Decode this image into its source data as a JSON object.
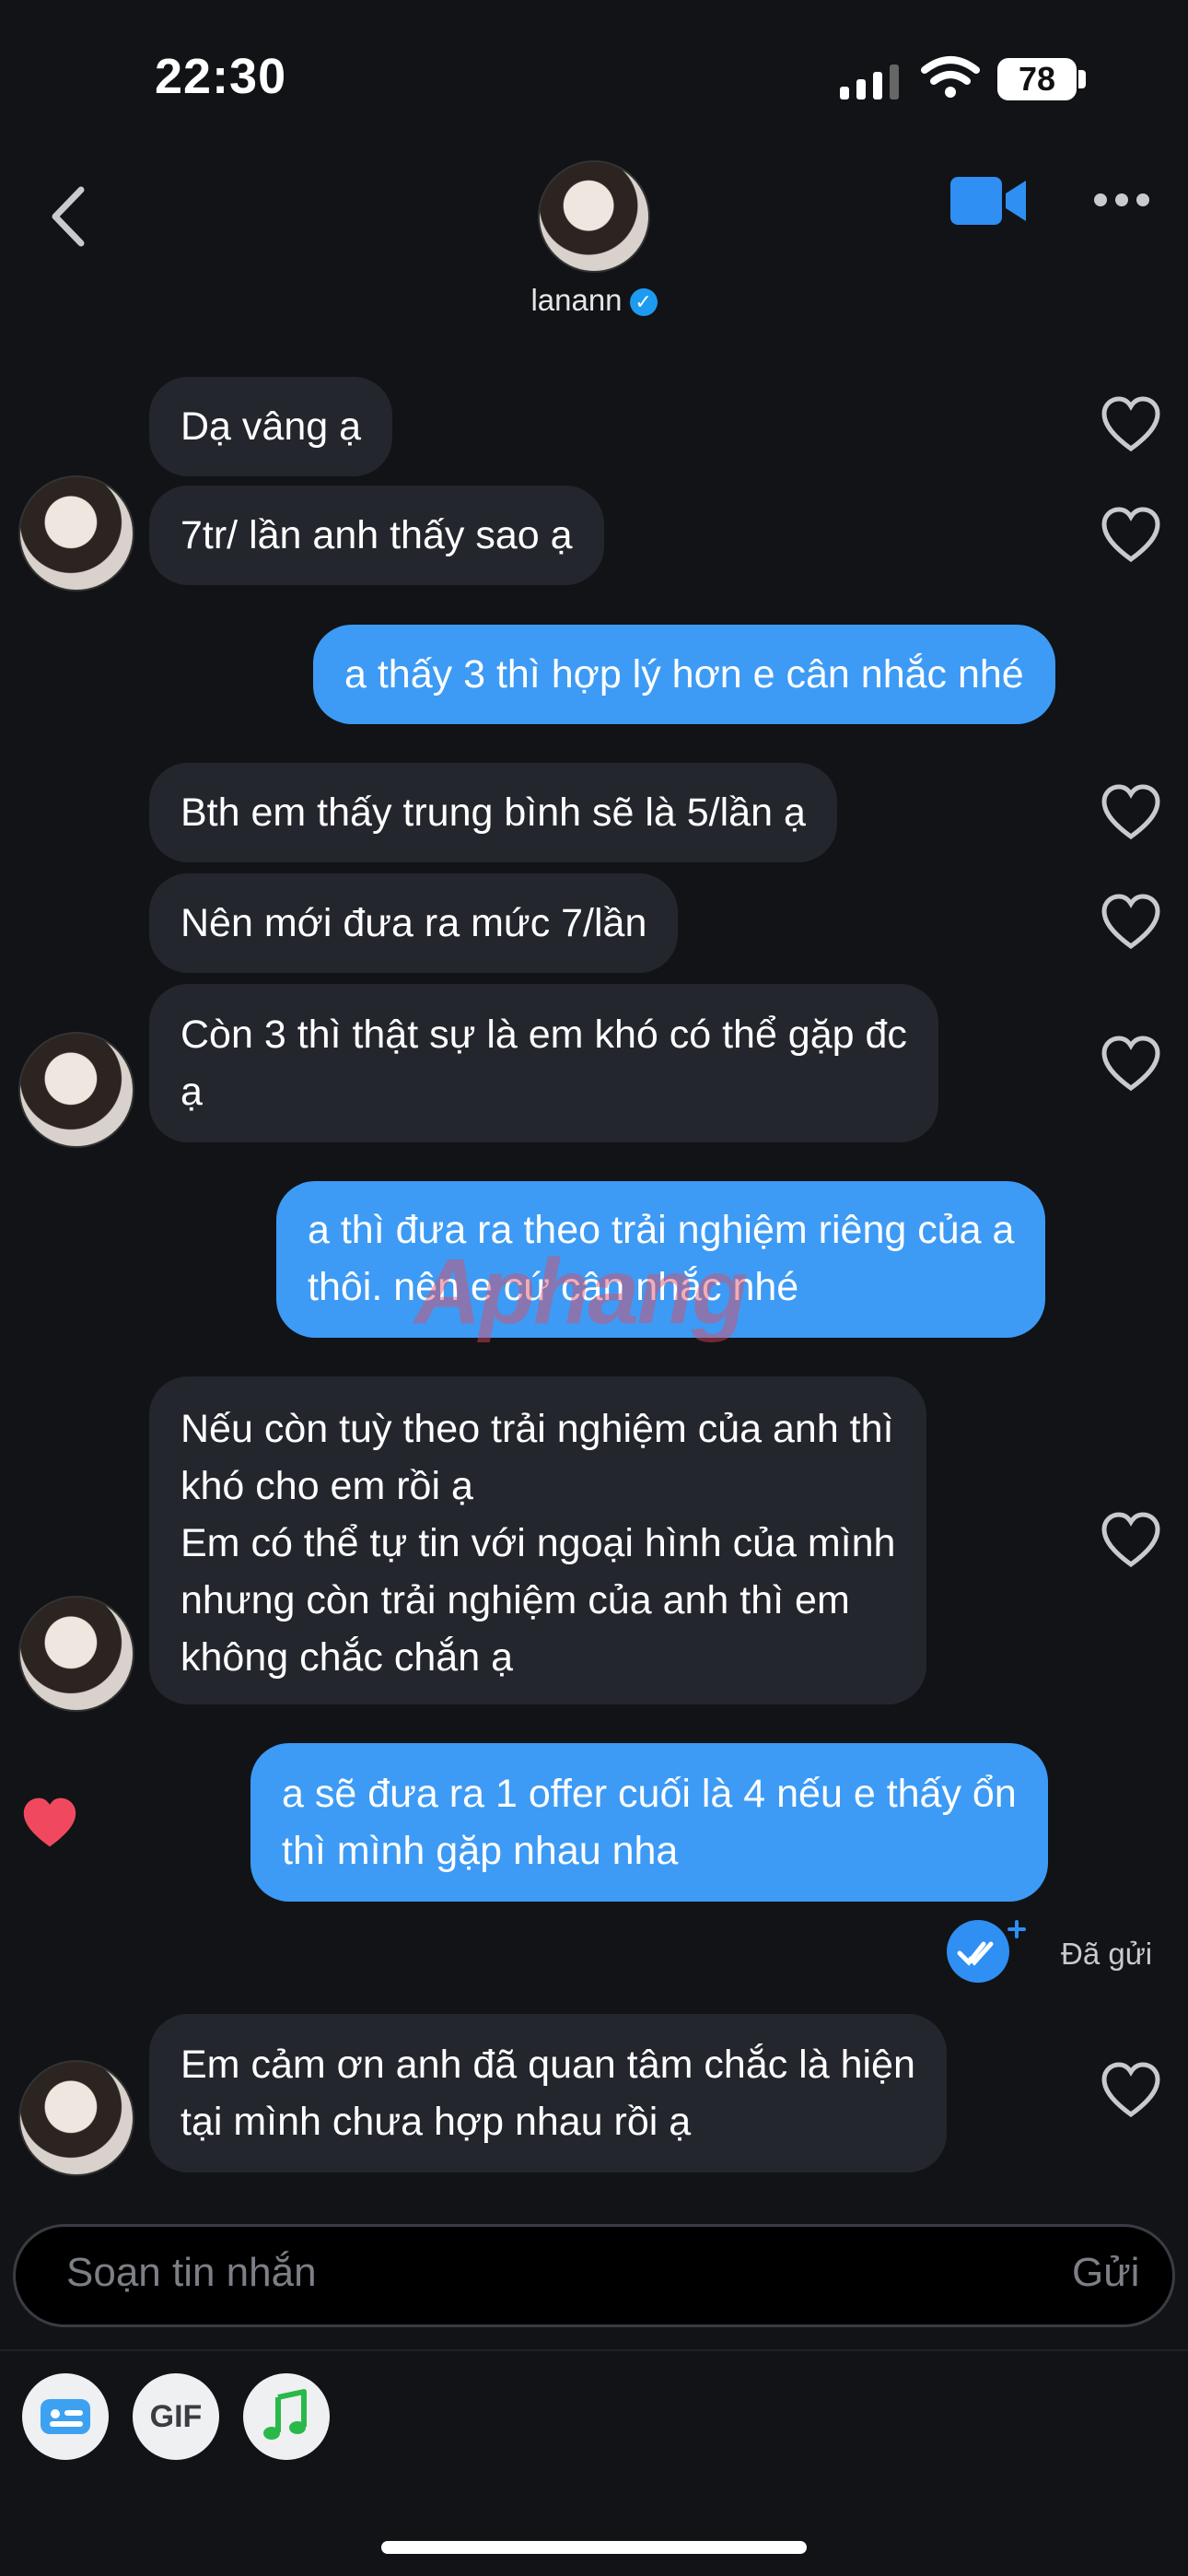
{
  "status_bar": {
    "time": "22:30",
    "battery": "78"
  },
  "header": {
    "name": "lanann"
  },
  "messages": [
    {
      "text": "Dạ vâng ạ",
      "from": "them"
    },
    {
      "text": "7tr/ lần anh thấy sao ạ",
      "from": "them"
    },
    {
      "text": "a thấy 3 thì hợp lý hơn e cân nhắc nhé",
      "from": "me"
    },
    {
      "text": "Bth em thấy trung bình sẽ là 5/lần ạ",
      "from": "them"
    },
    {
      "text": "Nên mới đưa ra mức 7/lần",
      "from": "them"
    },
    {
      "text": "Còn 3 thì thật sự là em khó có thể gặp đc\nạ",
      "from": "them"
    },
    {
      "text": "a thì đưa ra theo trải nghiệm riêng của a\nthôi. nên e cứ cân nhắc nhé",
      "from": "me"
    },
    {
      "text": "Nếu còn tuỳ theo trải nghiệm của anh thì\nkhó cho em rồi ạ\nEm có thể tự tin với ngoại hình của mình\nnhưng còn trải nghiệm của anh thì em\nkhông chắc chắn ạ",
      "from": "them"
    },
    {
      "text": "a sẽ đưa ra 1 offer cuối là 4 nếu e thấy ổn\nthì mình gặp nhau nha",
      "from": "me"
    },
    {
      "text": "Em cảm ơn anh đã quan tâm chắc là hiện\ntại mình chưa hợp nhau rồi ạ",
      "from": "them"
    }
  ],
  "sent_status": "Đã gửi",
  "composer": {
    "placeholder": "Soạn tin nhắn",
    "send_label": "Gửi"
  },
  "toolbar": {
    "gif_label": "GIF"
  },
  "watermark": "Aphang",
  "colors": {
    "outgoing": "#3d9bf5",
    "incoming": "#24262e",
    "background": "#111317",
    "liked_heart": "#f0495f"
  }
}
